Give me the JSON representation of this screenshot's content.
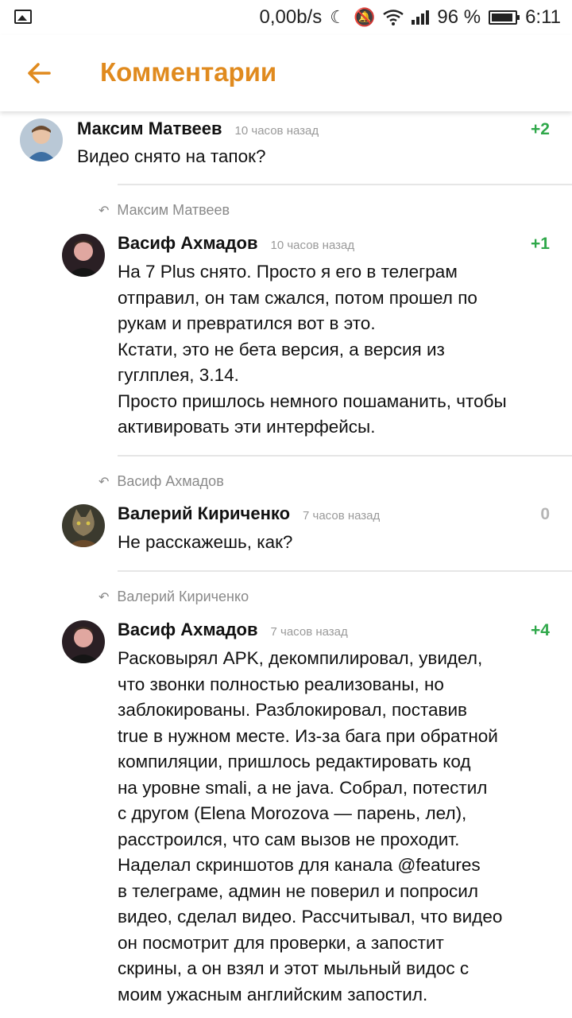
{
  "status_bar": {
    "speed": "0,00b/s",
    "battery_percent": "96 %",
    "time": "6:11",
    "icons": [
      "image-icon",
      "moon-icon",
      "mute-icon",
      "wifi-icon",
      "signal-icon",
      "battery-icon"
    ]
  },
  "header": {
    "title": "Комментарии",
    "accent_color": "#e08a1e"
  },
  "comments": [
    {
      "author": "Максим Матвеев",
      "time": "10 часов назад",
      "score": "+2",
      "text": "Видео снято на тапок?"
    },
    {
      "reply_to": "Максим Матвеев",
      "author": "Васиф Ахмадов",
      "time": "10 часов назад",
      "score": "+1",
      "text": "На 7 Plus снято. Просто я его в телеграм\nотправил, он там сжался, потом прошел по\nрукам и превратился вот в это.\nКстати, это не бета версия, а версия из\nгуглплея, 3.14.\nПросто пришлось немного пошаманить, чтобы\nактивировать эти интерфейсы."
    },
    {
      "reply_to": "Васиф Ахмадов",
      "author": "Валерий Кириченко",
      "time": "7 часов назад",
      "score": "0",
      "text": "Не расскажешь, как?"
    },
    {
      "reply_to": "Валерий Кириченко",
      "author": "Васиф Ахмадов",
      "time": "7 часов назад",
      "score": "+4",
      "text": "Расковырял APK, декомпилировал, увидел,\nчто звонки полностью реализованы, но\nзаблокированы. Разблокировал, поставив\ntrue в нужном месте. Из-за бага при обратной\nкомпиляции, пришлось редактировать код\nна уровне smali, а не java. Собрал, потестил\nс другом (Elena Morozova — парень, лел),\nрасстроился, что сам вызов не проходит.\nНаделал скриншотов для канала @features\nв телеграме, админ не поверил и попросил\nвидео, сделал видео. Рассчитывал, что видео\nон посмотрит для проверки, а запостит\nскрины, а он взял и этот мыльный видос с\nмоим ужасным английским запостил."
    }
  ]
}
